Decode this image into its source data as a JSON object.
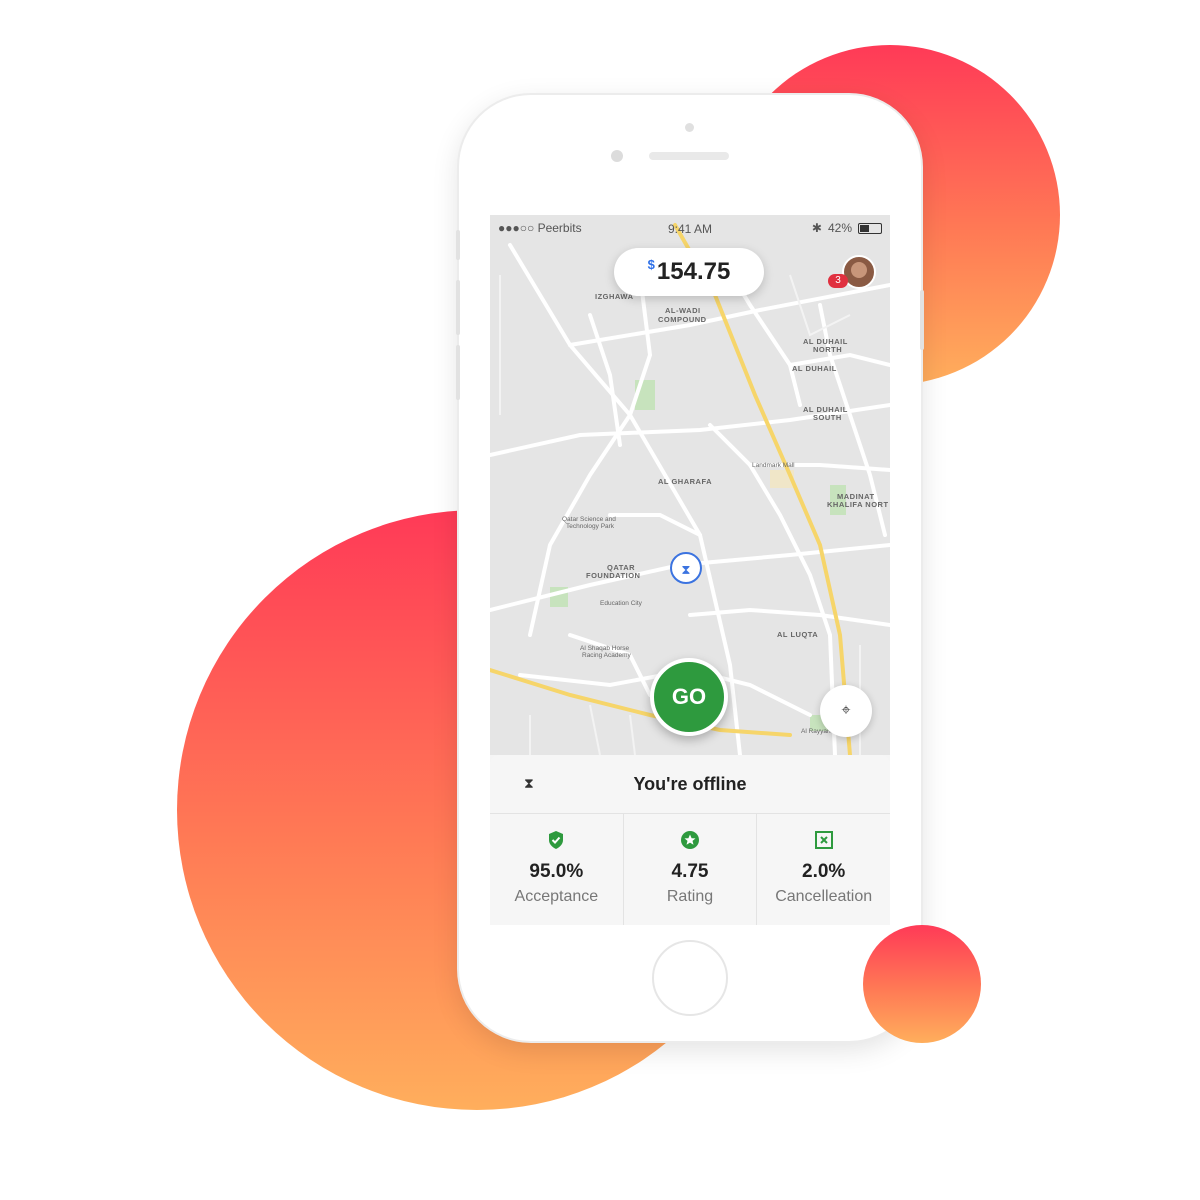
{
  "status_bar": {
    "carrier": "●●●○○ Peerbits",
    "time": "9:41 AM",
    "battery": "42%"
  },
  "earnings": {
    "currency": "$",
    "amount": "154.75"
  },
  "notifications": {
    "count": "3"
  },
  "map": {
    "labels": {
      "izghawa": "IZGHAWA",
      "al_wadi": "AL-WADI",
      "compound": "COMPOUND",
      "al_duhail_north_1": "AL DUHAIL",
      "al_duhail_north_2": "NORTH",
      "al_duhail": "AL DUHAIL",
      "al_duhail_south_1": "AL DUHAIL",
      "al_duhail_south_2": "SOUTH",
      "landmark_mall": "Landmark Mall",
      "al_gharafa": "AL GHARAFA",
      "madinat_khalifa_north_1": "MADINAT",
      "madinat_khalifa_north_2": "KHALIFA NORT",
      "qatar_science_1": "Qatar Science and",
      "qatar_science_2": "Technology Park",
      "qatar_foundation_1": "QATAR",
      "qatar_foundation_2": "FOUNDATION",
      "education_city": "Education City",
      "al_luqta": "AL LUQTA",
      "al_shaqab_1": "Al Shaqab Horse",
      "al_shaqab_2": "Racing Academy",
      "al_rayyan_park": "Al Rayyan Park"
    }
  },
  "actions": {
    "go_label": "GO"
  },
  "panel": {
    "status_title": "You're offline",
    "stats": [
      {
        "value": "95.0%",
        "label": "Acceptance"
      },
      {
        "value": "4.75",
        "label": "Rating"
      },
      {
        "value": "2.0%",
        "label": "Cancelleation"
      }
    ]
  },
  "colors": {
    "accent_green": "#2e9a3e",
    "accent_blue": "#2c6fe8",
    "badge_red": "#e0303f",
    "blob_top": "#ff3a57",
    "blob_bottom": "#ffae5c"
  }
}
